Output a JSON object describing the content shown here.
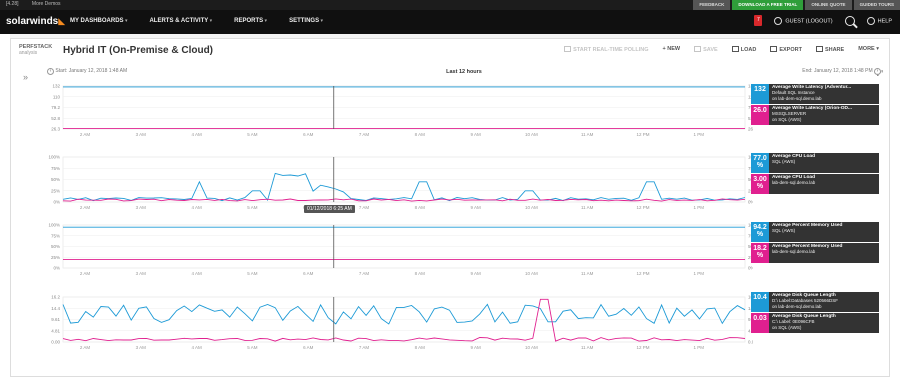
{
  "topbar": {
    "left": [
      "[4.28]",
      "More Demos"
    ],
    "pills": [
      "FEEDBACK",
      "DOWNLOAD A FREE TRIAL",
      "ONLINE QUOTE",
      "GUIDED TOURS"
    ]
  },
  "nav": {
    "logo": "solarwinds",
    "items": [
      "MY DASHBOARDS",
      "ALERTS & ACTIVITY",
      "REPORTS",
      "SETTINGS"
    ],
    "notification_count": "7",
    "user": "GUEST (LOGOUT)",
    "help": "HELP"
  },
  "page": {
    "logo_line1": "PERFSTACK",
    "logo_line2": "analysis",
    "title": "Hybrid IT (On-Premise & Cloud)",
    "toolbar": {
      "realtime": "START REAL-TIME POLLING",
      "new": "NEW",
      "save": "SAVE",
      "load": "LOAD",
      "export": "EXPORT",
      "share": "SHARE",
      "more": "MORE"
    }
  },
  "timeline": {
    "start_label": "Start:",
    "start": "January 12, 2018 1:48 AM",
    "range": "Last 12 hours",
    "end_label": "End:",
    "end": "January 12, 2018 1:48 PM"
  },
  "tooltip": "01/12/2018 6:25 AM",
  "colors": {
    "blue": "#1d9ad6",
    "pink": "#e0208f",
    "dark": "#101010",
    "green": "#2f9e3a"
  },
  "x_ticks": [
    "2 AM",
    "3 AM",
    "4 AM",
    "5 AM",
    "6 AM",
    "7 AM",
    "8 AM",
    "9 AM",
    "10 AM",
    "11 AM",
    "12 PM",
    "1 PM"
  ],
  "charts": [
    {
      "y_ticks": [
        "132",
        "110",
        "79.2",
        "52.8",
        "26.3"
      ],
      "legend": [
        {
          "value": "132",
          "color": "blue",
          "title": "Average Write Latency (Adventur...",
          "line2": "Default SQL Instance",
          "line3": "on lab-dem-sql.demo.lab"
        },
        {
          "value": "26.0",
          "color": "pink",
          "title": "Average Write Latency (Orion-OD...",
          "line2": "MSSQLSERVER",
          "line3": "on SQL (AWS)"
        }
      ]
    },
    {
      "y_ticks": [
        "100%",
        "75%",
        "50%",
        "25%",
        "0%"
      ],
      "legend": [
        {
          "value": "77.0 %",
          "color": "blue",
          "title": "Average CPU Load",
          "line2": "SQL (AWS)",
          "line3": ""
        },
        {
          "value": "3.00 %",
          "color": "pink",
          "title": "Average CPU Load",
          "line2": "lab-dem-sql.demo.lab",
          "line3": ""
        }
      ]
    },
    {
      "y_ticks": [
        "100%",
        "75%",
        "50%",
        "25%",
        "0%"
      ],
      "legend": [
        {
          "value": "94.2 %",
          "color": "blue",
          "title": "Average Percent Memory Used",
          "line2": "SQL (AWS)",
          "line3": ""
        },
        {
          "value": "18.2 %",
          "color": "pink",
          "title": "Average Percent Memory Used",
          "line2": "lab-dem-sql.demo.lab",
          "line3": ""
        }
      ]
    },
    {
      "y_ticks": [
        "16.2",
        "14.4",
        "9.61",
        "4.81",
        "0.00"
      ],
      "legend": [
        {
          "value": "10.4",
          "color": "blue",
          "title": "Average Disk Queue Length",
          "line2": "D:\\ Label:Databases 520566DSF",
          "line3": "on lab-dem-sql.demo.lab"
        },
        {
          "value": "0.03",
          "color": "pink",
          "title": "Average Disk Queue Length",
          "line2": "C:\\ Label: 0E096CFB",
          "line3": "on SQL (AWS)"
        }
      ]
    }
  ]
}
